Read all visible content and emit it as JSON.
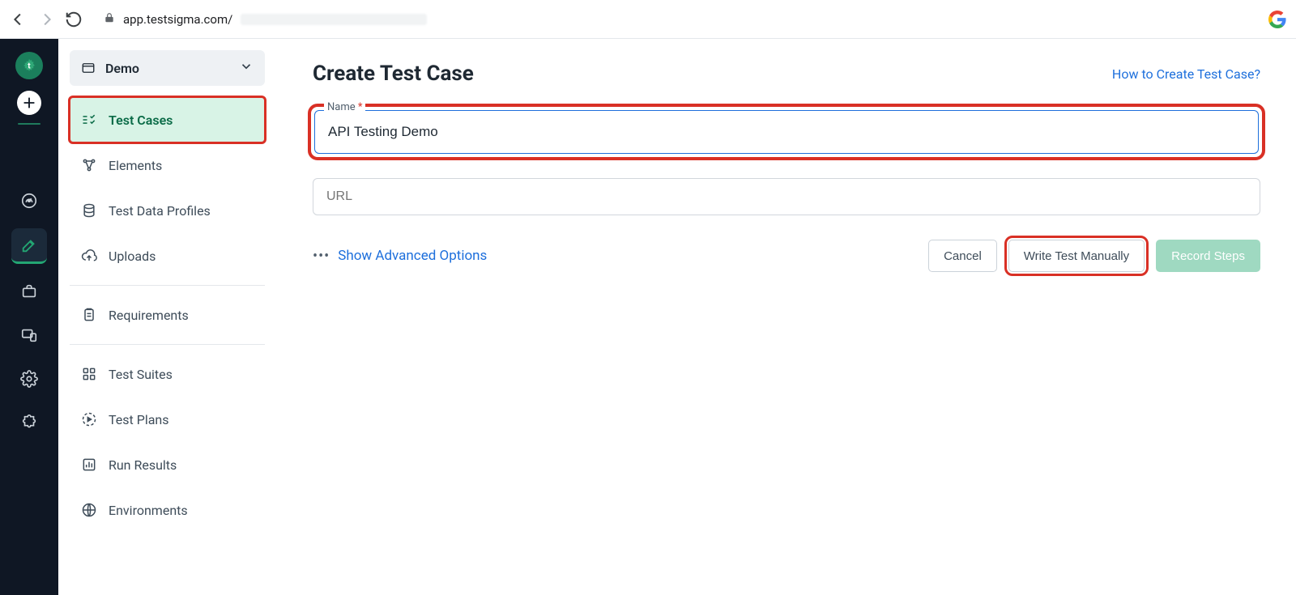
{
  "browser": {
    "url_host": "app.testsigma.com/"
  },
  "project": {
    "name": "Demo"
  },
  "sidebar": {
    "items": [
      {
        "label": "Test Cases"
      },
      {
        "label": "Elements"
      },
      {
        "label": "Test Data Profiles"
      },
      {
        "label": "Uploads"
      },
      {
        "label": "Requirements"
      },
      {
        "label": "Test Suites"
      },
      {
        "label": "Test Plans"
      },
      {
        "label": "Run Results"
      },
      {
        "label": "Environments"
      }
    ]
  },
  "main": {
    "title": "Create Test Case",
    "help_link": "How to Create Test Case?",
    "name_label": "Name",
    "name_required_mark": "*",
    "name_value": "API Testing Demo",
    "url_placeholder": "URL",
    "advanced_label": "Show Advanced Options",
    "cancel_label": "Cancel",
    "manual_label": "Write Test Manually",
    "record_label": "Record Steps"
  }
}
